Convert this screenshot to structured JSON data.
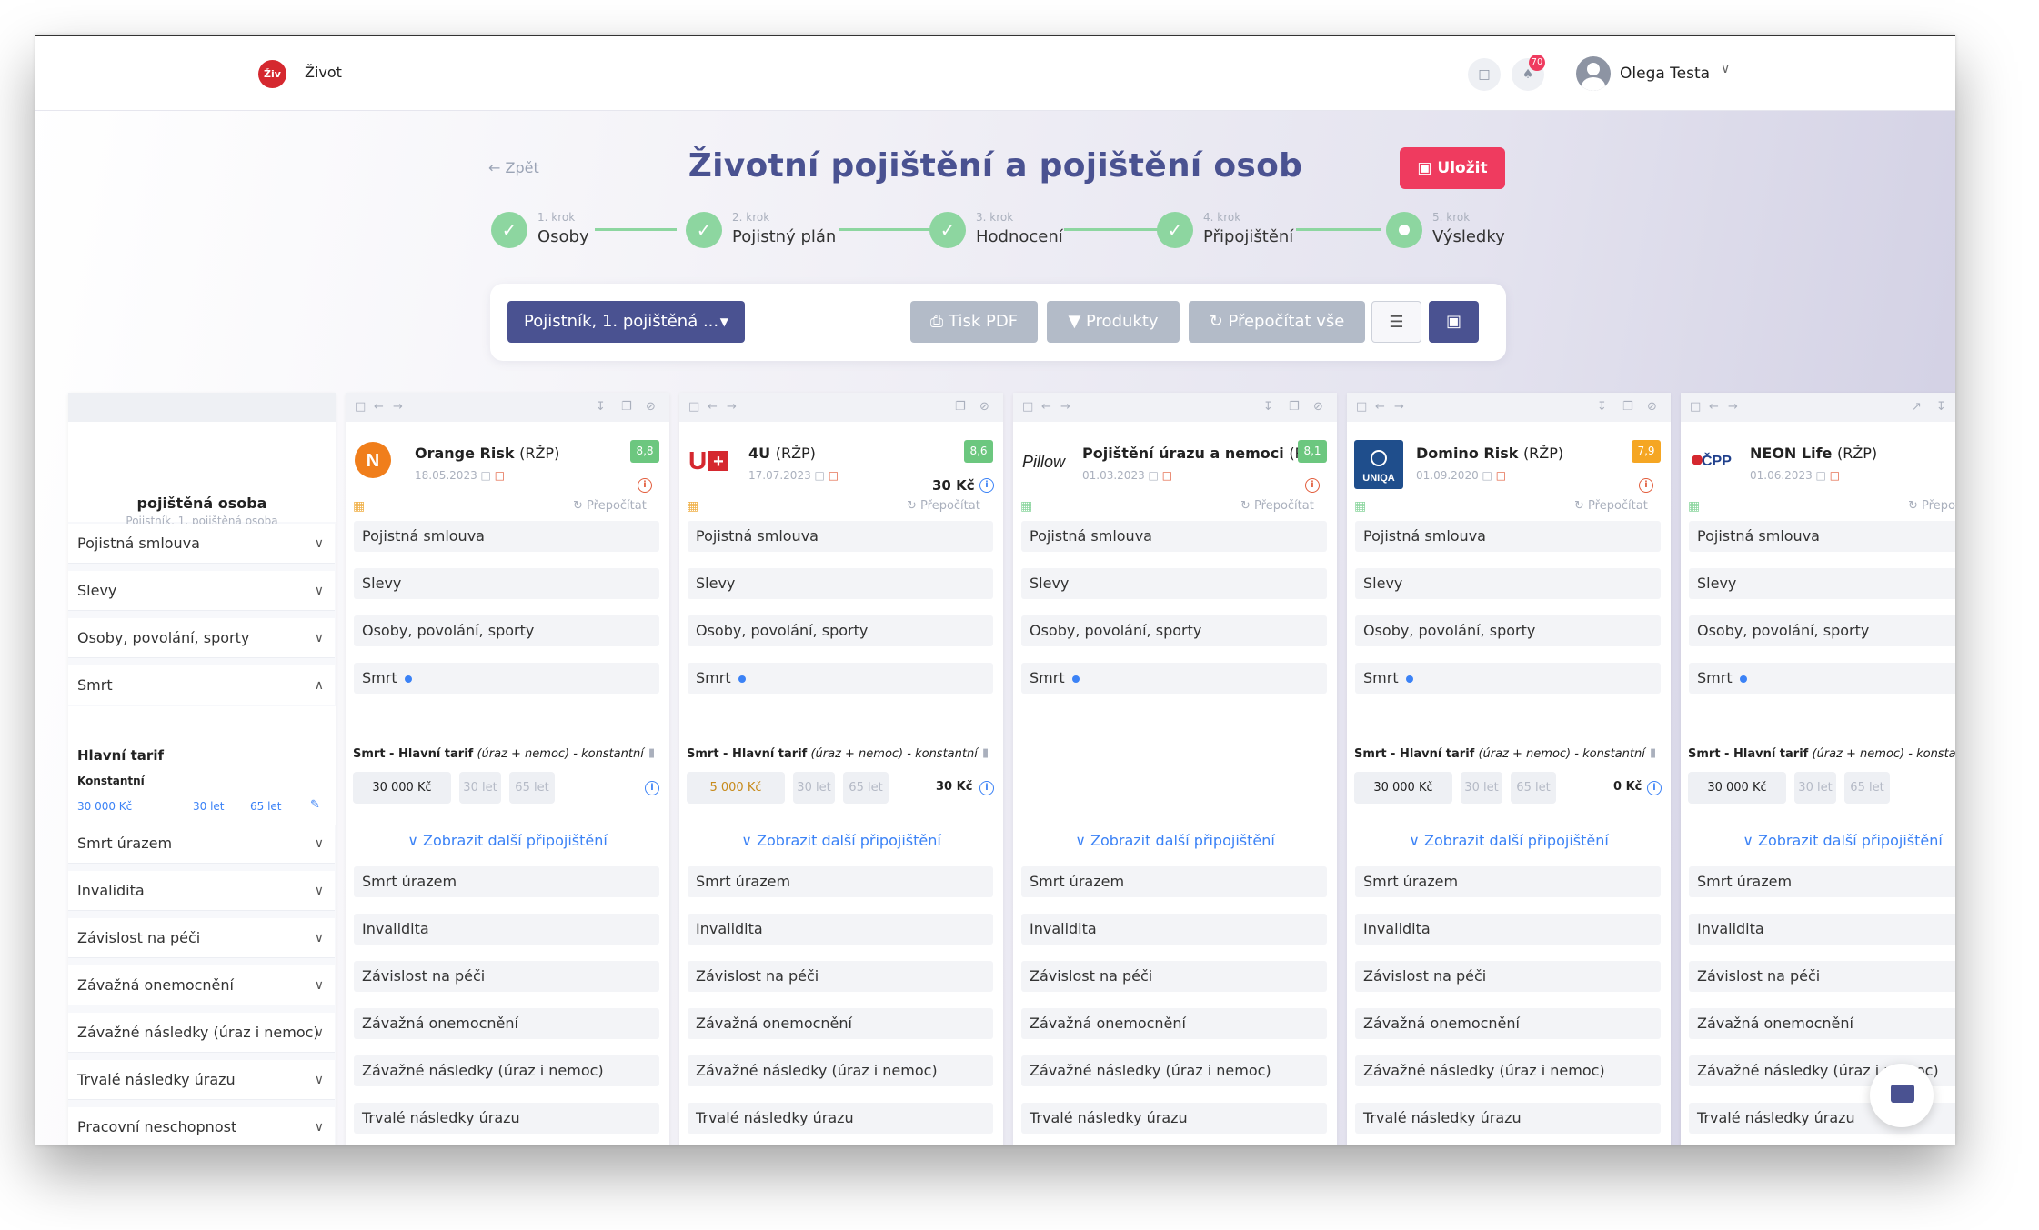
{
  "topbar": {
    "logo_text": "Živ",
    "app_title": "Život",
    "notifications_count": "70",
    "user_name": "Olega Testa"
  },
  "header": {
    "back_label": "← Zpět",
    "title": "Životní pojištění a pojištění osob",
    "save_label": "Uložit"
  },
  "steps": [
    {
      "sub": "1. krok",
      "name": "Osoby",
      "done": true
    },
    {
      "sub": "2. krok",
      "name": "Pojistný plán",
      "done": true
    },
    {
      "sub": "3. krok",
      "name": "Hodnocení",
      "done": true
    },
    {
      "sub": "4. krok",
      "name": "Připojištění",
      "done": true
    },
    {
      "sub": "5. krok",
      "name": "Výsledky",
      "done": false
    }
  ],
  "toolbar": {
    "person_select": "Pojistník, 1. pojištěná ...",
    "print_pdf": "Tisk PDF",
    "products": "Produkty",
    "recalc_all": "Přepočítat vše"
  },
  "left": {
    "title": "pojištěná osoba",
    "subtitle": "Pojistník, 1. pojištěná osoba",
    "tarif_title": "Hlavní tarif",
    "tarif_type": "Konstantní",
    "tarif_amount": "30 000 Kč",
    "tarif_term": "30 let",
    "tarif_age": "65 let"
  },
  "sections": [
    "Pojistná smlouva",
    "Slevy",
    "Osoby, povolání, sporty",
    "Smrt",
    "Smrt úrazem",
    "Invalidita",
    "Závislost na péči",
    "Závažná onemocnění",
    "Závažné následky (úraz i nemoc)",
    "Trvalé následky úrazu",
    "Pracovní neschopnost"
  ],
  "common": {
    "recalc": "Přepočítat",
    "tarif_prefix": "Smrt - Hlavní tarif",
    "tarif_suffix": "(úraz + nemoc) - konstantní",
    "show_more": "Zobrazit další připojištění",
    "term": "30 let",
    "age": "65 let"
  },
  "products": [
    {
      "name": "Orange Risk",
      "type": "(RŽP)",
      "date": "18.05.2023",
      "rating": "8,8",
      "rating_color": "#6cc77f",
      "amount": "30 000 Kč",
      "price": "",
      "price_top": "",
      "has_tarif": true
    },
    {
      "name": "4U",
      "type": "(RŽP)",
      "date": "17.07.2023",
      "rating": "8,6",
      "rating_color": "#6cc77f",
      "amount": "5 000 Kč",
      "price": "30 Kč",
      "price_top": "30 Kč",
      "has_tarif": true
    },
    {
      "name": "Pojištění úrazu a nemoci",
      "type": "(RPO",
      "date": "01.03.2023",
      "rating": "8,1",
      "rating_color": "#6cc77f",
      "amount": "",
      "price": "",
      "price_top": "",
      "has_tarif": false
    },
    {
      "name": "Domino Risk",
      "type": "(RŽP)",
      "date": "01.09.2020",
      "rating": "7,9",
      "rating_color": "#f5a623",
      "amount": "30 000 Kč",
      "price": "0 Kč",
      "price_top": "",
      "has_tarif": true
    },
    {
      "name": "NEON Life",
      "type": "(RŽP)",
      "date": "01.06.2023",
      "rating": "",
      "rating_color": "",
      "amount": "30 000 Kč",
      "price": "",
      "price_top": "",
      "has_tarif": true
    }
  ],
  "logos": {
    "p0": "ORANGE",
    "p1": "U+",
    "p2": "Pillow",
    "p3": "UNIQA",
    "p4": "ČPP"
  }
}
